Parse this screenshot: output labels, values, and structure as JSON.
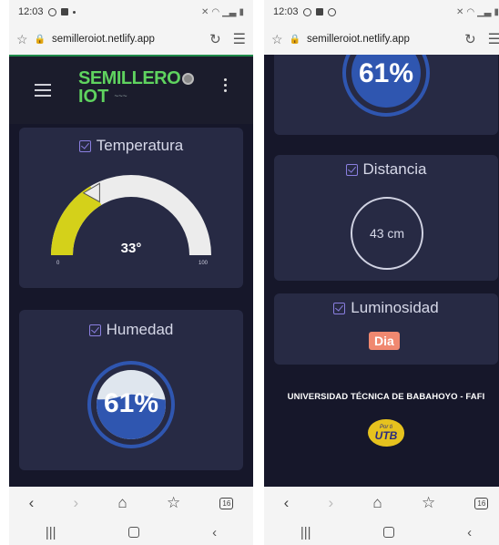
{
  "screens": [
    {
      "status": {
        "time": "12:03"
      },
      "browser": {
        "url": "semilleroiot.netlify.app",
        "tab_count": "16"
      },
      "app": {
        "logo_line1": "SEMILLERO",
        "logo_line2": "IOT",
        "logo_sub": "~~~"
      },
      "temperature": {
        "title": "Temperatura",
        "value": "33°",
        "min": "0",
        "max": "100",
        "fraction": 0.33
      },
      "humidity": {
        "title": "Humedad",
        "value": "61%",
        "fraction": 0.61
      }
    },
    {
      "status": {
        "time": "12:03"
      },
      "browser": {
        "url": "semilleroiot.netlify.app",
        "tab_count": "16"
      },
      "humidity_partial": {
        "value": "61%"
      },
      "distance": {
        "title": "Distancia",
        "value": "43 cm"
      },
      "light": {
        "title": "Luminosidad",
        "value": "Dia"
      },
      "footer": {
        "university": "UNIVERSIDAD TÉCNICA DE BABAHOYO - FAFI",
        "logo_small": "Por ti",
        "logo_big": "UTB"
      }
    }
  ],
  "colors": {
    "background": "#16172a",
    "card": "#272a44",
    "accent_green": "#5fd35f",
    "gauge_fill": "#d4d11a",
    "gauge_track": "#ececec",
    "water_blue": "#2f56b0",
    "badge_orange": "#f08870",
    "utb_yellow": "#e6c21e"
  }
}
